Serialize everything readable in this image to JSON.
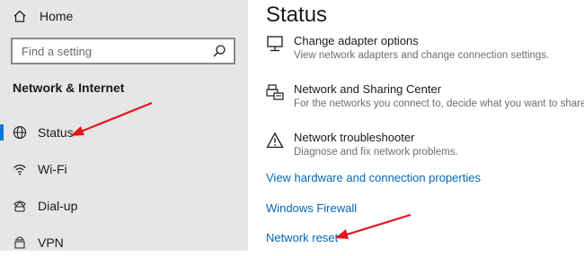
{
  "sidebar": {
    "home_label": "Home",
    "search_placeholder": "Find a setting",
    "section_title": "Network & Internet",
    "items": [
      {
        "label": "Status",
        "icon": "globe-icon"
      },
      {
        "label": "Wi-Fi",
        "icon": "wifi-icon"
      },
      {
        "label": "Dial-up",
        "icon": "dialup-icon"
      },
      {
        "label": "VPN",
        "icon": "vpn-icon"
      }
    ]
  },
  "main": {
    "title": "Status",
    "entries": [
      {
        "title": "Change adapter options",
        "desc": "View network adapters and change connection settings.",
        "icon": "monitor-icon"
      },
      {
        "title": "Network and Sharing Center",
        "desc": "For the networks you connect to, decide what you want to share.",
        "icon": "printer-share-icon"
      },
      {
        "title": "Network troubleshooter",
        "desc": "Diagnose and fix network problems.",
        "icon": "warning-icon"
      }
    ],
    "links": [
      "View hardware and connection properties",
      "Windows Firewall",
      "Network reset"
    ]
  },
  "colors": {
    "sidebar_bg": "#e6e6e6",
    "accent": "#0078d7",
    "link": "#0067b8",
    "annotation_arrow": "#e8141c"
  }
}
